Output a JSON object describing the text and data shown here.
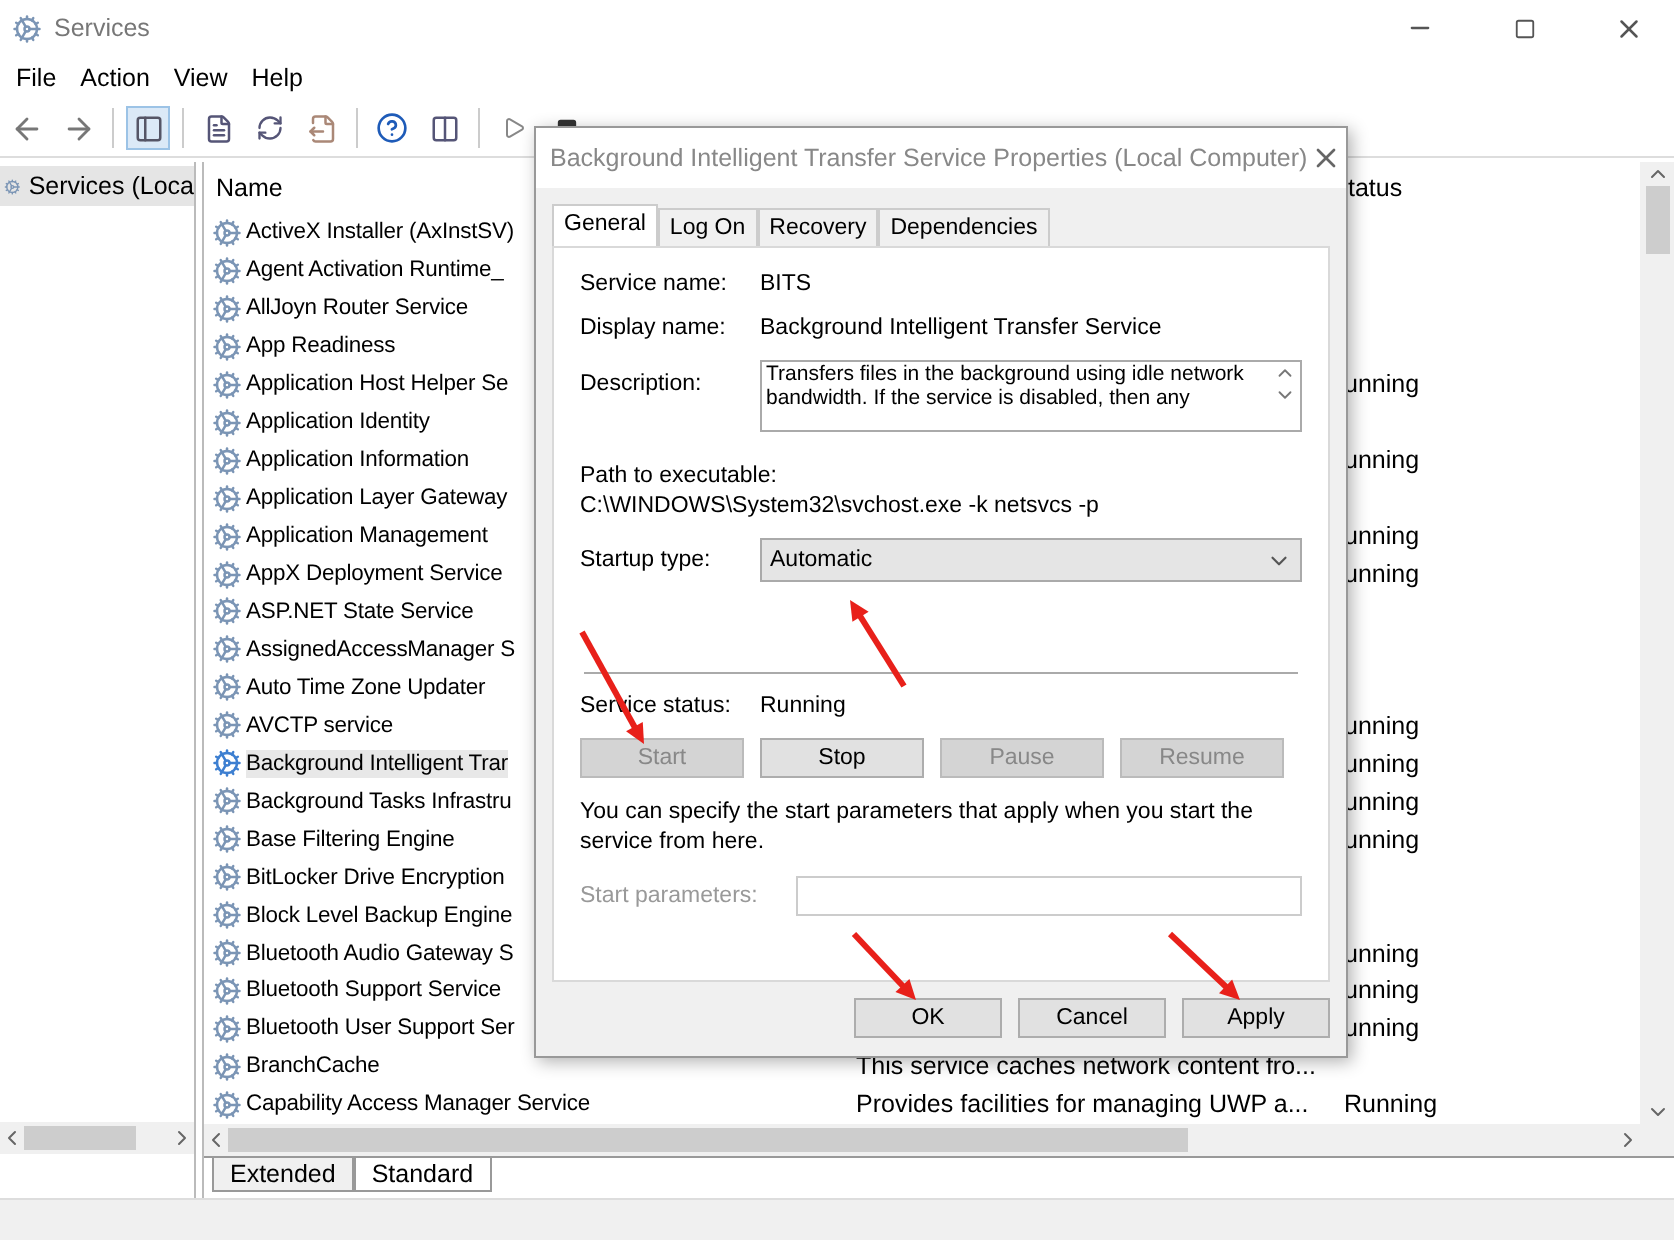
{
  "window": {
    "title": "Services"
  },
  "menu": [
    "File",
    "Action",
    "View",
    "Help"
  ],
  "tree": {
    "label": "Services (Loca",
    "selected": true
  },
  "table": {
    "columns": [
      "Name",
      "tatus"
    ],
    "rows": [
      {
        "name": "ActiveX Installer (AxInstSV)",
        "description": "",
        "status": "",
        "selected": false
      },
      {
        "name": "Agent Activation Runtime_",
        "description": "",
        "status": "",
        "selected": false
      },
      {
        "name": "AllJoyn Router Service",
        "description": "",
        "status": "",
        "selected": false
      },
      {
        "name": "App Readiness",
        "description": "",
        "status": "",
        "selected": false
      },
      {
        "name": "Application Host Helper Se",
        "description": "",
        "status": "unning",
        "selected": false
      },
      {
        "name": "Application Identity",
        "description": "",
        "status": "",
        "selected": false
      },
      {
        "name": "Application Information",
        "description": "",
        "status": "unning",
        "selected": false
      },
      {
        "name": "Application Layer Gateway",
        "description": "",
        "status": "",
        "selected": false
      },
      {
        "name": "Application Management",
        "description": "",
        "status": "unning",
        "selected": false
      },
      {
        "name": "AppX Deployment Service",
        "description": "",
        "status": "unning",
        "selected": false
      },
      {
        "name": "ASP.NET State Service",
        "description": "",
        "status": "",
        "selected": false
      },
      {
        "name": "AssignedAccessManager S",
        "description": "",
        "status": "",
        "selected": false
      },
      {
        "name": "Auto Time Zone Updater",
        "description": "",
        "status": "",
        "selected": false
      },
      {
        "name": "AVCTP service",
        "description": "",
        "status": "unning",
        "selected": false
      },
      {
        "name": "Background Intelligent Trar",
        "description": "",
        "status": "unning",
        "selected": true
      },
      {
        "name": "Background Tasks Infrastru",
        "description": "",
        "status": "unning",
        "selected": false
      },
      {
        "name": "Base Filtering Engine",
        "description": "",
        "status": "unning",
        "selected": false
      },
      {
        "name": "BitLocker Drive Encryption",
        "description": "",
        "status": "",
        "selected": false
      },
      {
        "name": "Block Level Backup Engine",
        "description": "",
        "status": "",
        "selected": false
      },
      {
        "name": "Bluetooth Audio Gateway S",
        "description": "",
        "status": "unning",
        "selected": false
      },
      {
        "name": "Bluetooth Support Service",
        "description": "",
        "status": "unning",
        "selected": false
      },
      {
        "name": "Bluetooth User Support Ser",
        "description": "",
        "status": "unning",
        "selected": false
      },
      {
        "name": "BranchCache",
        "description": "This service caches network content fro...",
        "status": "",
        "selected": false
      },
      {
        "name": "Capability Access Manager Service",
        "description": "Provides facilities for managing UWP a...",
        "status": "Running",
        "selected": false
      }
    ]
  },
  "view_tabs": [
    {
      "label": "Extended",
      "selected": false
    },
    {
      "label": "Standard",
      "selected": true
    }
  ],
  "dialog": {
    "title": "Background Intelligent Transfer Service Properties (Local Computer)",
    "tabs": [
      {
        "label": "General",
        "selected": true
      },
      {
        "label": "Log On",
        "selected": false
      },
      {
        "label": "Recovery",
        "selected": false
      },
      {
        "label": "Dependencies",
        "selected": false
      }
    ],
    "fields": [
      {
        "label": "Service name:",
        "value": "BITS"
      },
      {
        "label": "Display name:",
        "value": "Background Intelligent Transfer Service"
      }
    ],
    "description": {
      "label": "Description:",
      "value": "Transfers files in the background using idle network bandwidth. If the service is disabled, then any"
    },
    "path": {
      "label": "Path to executable:",
      "value": "C:\\WINDOWS\\System32\\svchost.exe -k netsvcs -p"
    },
    "startup": {
      "label": "Startup type:",
      "value": "Automatic"
    },
    "status": {
      "label": "Service status:",
      "value": "Running"
    },
    "controls": [
      {
        "label": "Start",
        "disabled": true
      },
      {
        "label": "Stop",
        "disabled": false
      },
      {
        "label": "Pause",
        "disabled": true
      },
      {
        "label": "Resume",
        "disabled": true
      }
    ],
    "hint": "You can specify the start parameters that apply when you start the service from here.",
    "parameters": {
      "label": "Start parameters:",
      "disabled": true
    },
    "buttons": [
      "OK",
      "Cancel",
      "Apply"
    ]
  }
}
